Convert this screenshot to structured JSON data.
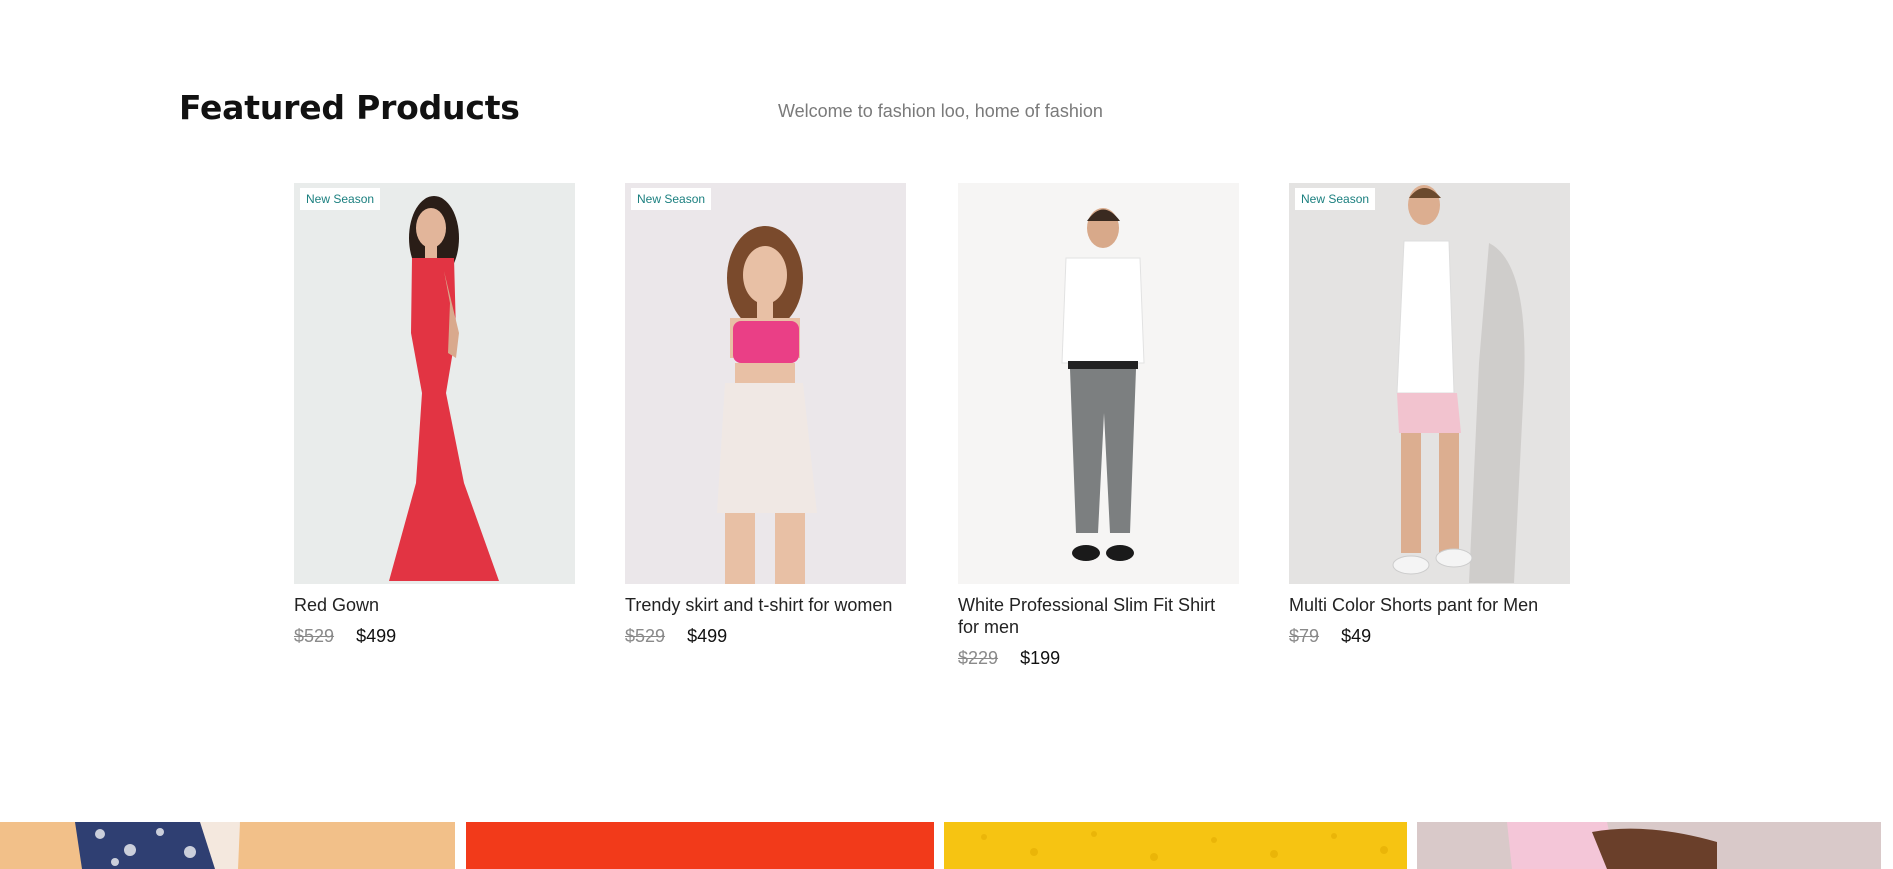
{
  "featured": {
    "title": "Featured Products",
    "subtitle": "Welcome to fashion loo, home of fashion"
  },
  "products": [
    {
      "name": "Red Gown",
      "old_price": "$529",
      "price": "$499",
      "badge": "New Season",
      "image": "woman-red-gown-photo"
    },
    {
      "name": "Trendy skirt and t-shirt for women",
      "old_price": "$529",
      "price": "$499",
      "badge": "New Season",
      "image": "woman-pink-top-white-skirt-photo"
    },
    {
      "name": "White Professional Slim Fit Shirt for men",
      "old_price": "$229",
      "price": "$199",
      "badge": "",
      "image": "man-white-shirt-grey-pants-photo"
    },
    {
      "name": "Multi Color Shorts pant for Men",
      "old_price": "$79",
      "price": "$49",
      "badge": "New Season",
      "image": "man-tank-top-pink-shorts-photo"
    }
  ],
  "banners": [
    {
      "image": "patterned-shirt-photo",
      "color": "#f2c089"
    },
    {
      "image": "red-background-photo",
      "color": "#f23a1a"
    },
    {
      "image": "yellow-texture-photo",
      "color": "#f6c412"
    },
    {
      "image": "pink-shirt-photo",
      "color": "#d9c9c9"
    }
  ],
  "colors": {
    "badge_text": "#1a7f7f",
    "old_price": "#8a8a8a",
    "subtitle": "#7a7a7a"
  }
}
